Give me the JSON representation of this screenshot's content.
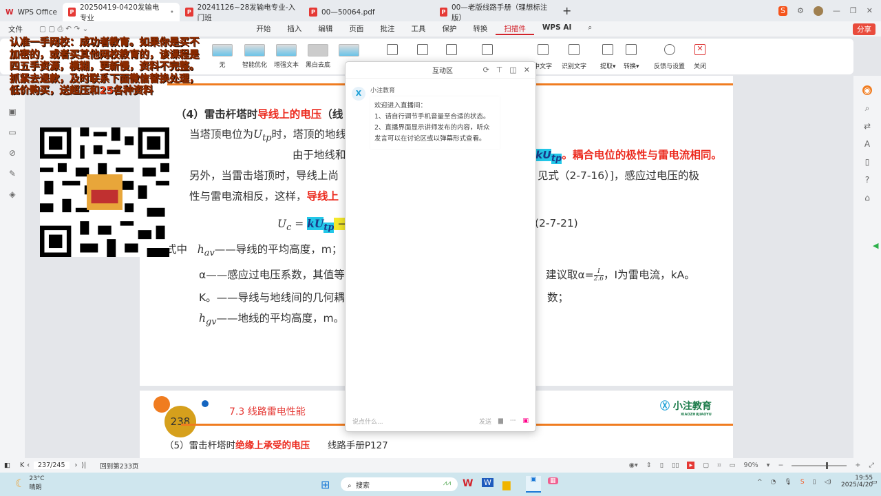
{
  "tabs": [
    {
      "label": "WPS Office"
    },
    {
      "label": "20250419-0420发输电专业"
    },
    {
      "label": "20241126~28发输电专业-入门班"
    },
    {
      "label": "00—50064.pdf"
    },
    {
      "label": "00—老版线路手册（理想标注版）"
    }
  ],
  "menubar": {
    "file": "文件",
    "items": [
      "开始",
      "插入",
      "编辑",
      "页面",
      "批注",
      "工具",
      "保护",
      "转换",
      "扫描件",
      "WPS AI"
    ],
    "active": "扫描件"
  },
  "ribbon": {
    "items": [
      "无",
      "智能优化",
      "增强文本",
      "黑白去底",
      "",
      "",
      "",
      "",
      "",
      "中文字",
      "识别文字",
      "提取",
      "转换",
      "反馈与设置",
      "关闭"
    ]
  },
  "watermark": "认准一手网校：成功者教育。如果你是买不加密的，或者买其他网校教育的，该课程是四五手资源，模糊，更新慢，资料不完整。抓紧去退款，及时联系下面微信替换处理，低价购买，送超压和25各种资料",
  "page1": {
    "heading_prefix": "（4）雷击杆塔时",
    "heading_red": "导线上的电压",
    "heading_suffix": "（线",
    "line1": "当塔顶电位为",
    "line1_var": "U",
    "line1_sub": "tp",
    "line1_rest": "时，塔顶的地线",
    "line2": "由于地线和",
    "line2_hl": "kU",
    "line2_hl_sub": "tp",
    "line2_red": "。耦合电位的极性与雷电流相同。",
    "line3": "另外，当雷击塔顶时，导线上尚",
    "line3_right": "见式（2-7-16）]，感应过电压的极",
    "line4": "性与雷电流相反，这样，",
    "line4_red": "导线上",
    "eq_lhs": "U",
    "eq_lhs_sub": "c",
    "eq_eq": " = ",
    "eq_hl": "kU",
    "eq_hl_sub": "tp",
    "eq_minus": " − U",
    "eq_no": "(2-7-21)",
    "where": "式中",
    "hav": "h",
    "hav_sub": "av",
    "hav_desc": "——导线的平均高度，m；",
    "alpha": "α——感应过电压系数，其值等",
    "alpha_right": "建议取α=",
    "frac_num": "I",
    "frac_den": "2.6",
    "alpha_tail": "，I为雷电流，kA。",
    "k0": "K。——导线与地线间的几何耦",
    "k0_right": "数；",
    "hgv": "h",
    "hgv_sub": "gv",
    "hgv_desc": "——地线的平均高度，m。"
  },
  "page2": {
    "page_number": "238",
    "section": "7.3   线路雷电性能",
    "brand": "小注教育",
    "brand_sub": "XIAOZHUJIAOYU",
    "line_prefix": "（5）雷击杆塔时",
    "line_red": "绝缘上承受的电压",
    "line_ref": "线路手册P127"
  },
  "popup": {
    "title": "互动区",
    "sender": "小注教育",
    "message": [
      "欢迎进入直播间：",
      "1、请自行调节手机音量至合适的状态。",
      "2、直播界面显示讲师发布的内容，听众发言可以在讨论区或以弹幕形式查看。"
    ],
    "input_placeholder": "说点什么...",
    "send": "发送"
  },
  "statusbar": {
    "page": "237/245",
    "goto": "回到第233页",
    "zoom": "90%"
  },
  "taskbar": {
    "weather_temp": "23°C",
    "weather_desc": "晴朗",
    "search": "搜索",
    "time": "19:55",
    "date": "2025/4/20"
  },
  "colors": {
    "accent": "#d2242c",
    "orange": "#f07c20",
    "highlight": "#22c7e8"
  }
}
